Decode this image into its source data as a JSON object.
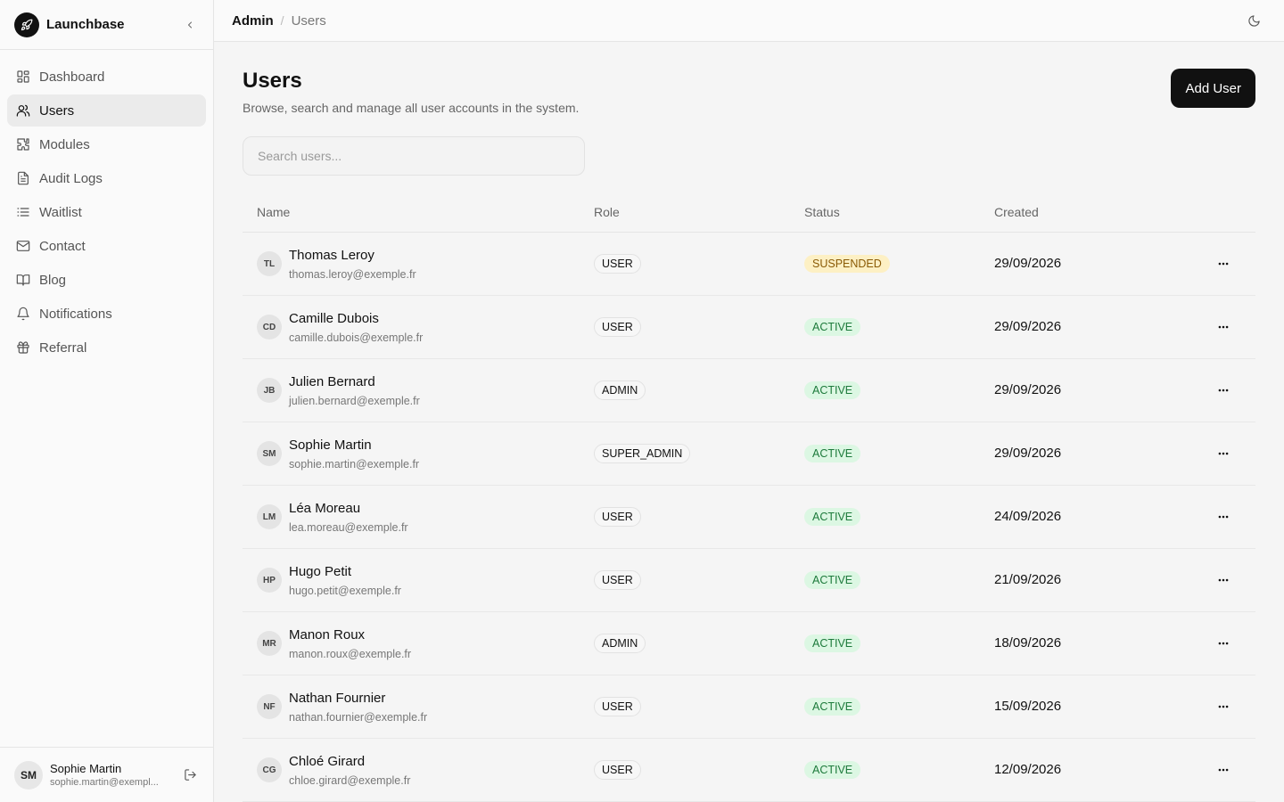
{
  "app": {
    "name": "Launchbase"
  },
  "sidebar": {
    "items": [
      {
        "label": "Dashboard",
        "icon": "dashboard-icon"
      },
      {
        "label": "Users",
        "icon": "users-icon",
        "active": true
      },
      {
        "label": "Modules",
        "icon": "puzzle-icon"
      },
      {
        "label": "Audit Logs",
        "icon": "document-icon"
      },
      {
        "label": "Waitlist",
        "icon": "list-icon"
      },
      {
        "label": "Contact",
        "icon": "mail-icon"
      },
      {
        "label": "Blog",
        "icon": "book-icon"
      },
      {
        "label": "Notifications",
        "icon": "bell-icon"
      },
      {
        "label": "Referral",
        "icon": "gift-icon"
      }
    ],
    "footer": {
      "initials": "SM",
      "name": "Sophie Martin",
      "email": "sophie.martin@exempl..."
    }
  },
  "breadcrumb": {
    "parent": "Admin",
    "separator": "/",
    "current": "Users"
  },
  "page": {
    "title": "Users",
    "subtitle": "Browse, search and manage all user accounts in the system.",
    "add_button": "Add User",
    "search_placeholder": "Search users..."
  },
  "table": {
    "headers": {
      "name": "Name",
      "role": "Role",
      "status": "Status",
      "created": "Created"
    },
    "rows": [
      {
        "initials": "TL",
        "name": "Thomas Leroy",
        "email": "thomas.leroy@exemple.fr",
        "role": "USER",
        "status": "SUSPENDED",
        "created": "29/09/2026"
      },
      {
        "initials": "CD",
        "name": "Camille Dubois",
        "email": "camille.dubois@exemple.fr",
        "role": "USER",
        "status": "ACTIVE",
        "created": "29/09/2026"
      },
      {
        "initials": "JB",
        "name": "Julien Bernard",
        "email": "julien.bernard@exemple.fr",
        "role": "ADMIN",
        "status": "ACTIVE",
        "created": "29/09/2026"
      },
      {
        "initials": "SM",
        "name": "Sophie Martin",
        "email": "sophie.martin@exemple.fr",
        "role": "SUPER_ADMIN",
        "status": "ACTIVE",
        "created": "29/09/2026"
      },
      {
        "initials": "LM",
        "name": "Léa Moreau",
        "email": "lea.moreau@exemple.fr",
        "role": "USER",
        "status": "ACTIVE",
        "created": "24/09/2026"
      },
      {
        "initials": "HP",
        "name": "Hugo Petit",
        "email": "hugo.petit@exemple.fr",
        "role": "USER",
        "status": "ACTIVE",
        "created": "21/09/2026"
      },
      {
        "initials": "MR",
        "name": "Manon Roux",
        "email": "manon.roux@exemple.fr",
        "role": "ADMIN",
        "status": "ACTIVE",
        "created": "18/09/2026"
      },
      {
        "initials": "NF",
        "name": "Nathan Fournier",
        "email": "nathan.fournier@exemple.fr",
        "role": "USER",
        "status": "ACTIVE",
        "created": "15/09/2026"
      },
      {
        "initials": "CG",
        "name": "Chloé Girard",
        "email": "chloe.girard@exemple.fr",
        "role": "USER",
        "status": "ACTIVE",
        "created": "12/09/2026"
      }
    ]
  },
  "colors": {
    "primary": "#111111",
    "active_bg": "#dcf7e3",
    "active_fg": "#1d7a3b",
    "suspended_bg": "#fdf0c4",
    "suspended_fg": "#8a5a05"
  }
}
